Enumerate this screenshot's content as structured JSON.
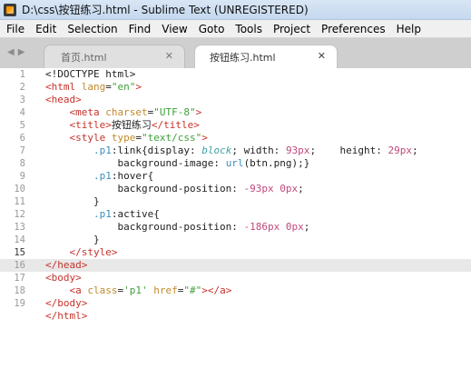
{
  "window": {
    "title": "D:\\css\\按钮练习.html - Sublime Text (UNREGISTERED)"
  },
  "menu": [
    "File",
    "Edit",
    "Selection",
    "Find",
    "View",
    "Goto",
    "Tools",
    "Project",
    "Preferences",
    "Help"
  ],
  "tabs": [
    {
      "label": "首页.html",
      "active": false
    },
    {
      "label": "按钮练习.html",
      "active": true
    }
  ],
  "editor": {
    "current_line": 15,
    "line_numbers": [
      "1",
      "2",
      "3",
      "4",
      "5",
      "6",
      "7",
      "8",
      "9",
      "10",
      "11",
      "12",
      "13",
      "14",
      "15",
      "16",
      "17",
      "18",
      "19"
    ],
    "lines": [
      [
        {
          "t": "<!DOCTYPE html>",
          "c": "plain"
        }
      ],
      [
        {
          "t": "<html ",
          "c": "tag"
        },
        {
          "t": "lang",
          "c": "attr"
        },
        {
          "t": "=",
          "c": "plain"
        },
        {
          "t": "\"en\"",
          "c": "str"
        },
        {
          "t": ">",
          "c": "tag"
        }
      ],
      [
        {
          "t": "<head>",
          "c": "tag"
        }
      ],
      [
        {
          "t": "    ",
          "c": "plain"
        },
        {
          "t": "<meta ",
          "c": "tag"
        },
        {
          "t": "charset",
          "c": "attr"
        },
        {
          "t": "=",
          "c": "plain"
        },
        {
          "t": "\"UTF-8\"",
          "c": "str"
        },
        {
          "t": ">",
          "c": "tag"
        }
      ],
      [
        {
          "t": "    ",
          "c": "plain"
        },
        {
          "t": "<title>",
          "c": "tag"
        },
        {
          "t": "按钮练习",
          "c": "plain"
        },
        {
          "t": "</title>",
          "c": "tag"
        }
      ],
      [
        {
          "t": "    ",
          "c": "plain"
        },
        {
          "t": "<style ",
          "c": "tag"
        },
        {
          "t": "type",
          "c": "attr"
        },
        {
          "t": "=",
          "c": "plain"
        },
        {
          "t": "\"text/css\"",
          "c": "str"
        },
        {
          "t": ">",
          "c": "tag"
        }
      ],
      [
        {
          "t": "        ",
          "c": "plain"
        },
        {
          "t": ".p1",
          "c": "fn"
        },
        {
          "t": ":link{display: ",
          "c": "plain"
        },
        {
          "t": "block",
          "c": "ital"
        },
        {
          "t": "; width: ",
          "c": "plain"
        },
        {
          "t": "93px",
          "c": "num"
        },
        {
          "t": ";    height: ",
          "c": "plain"
        },
        {
          "t": "29px",
          "c": "num"
        },
        {
          "t": ";",
          "c": "plain"
        }
      ],
      [
        {
          "t": "            background-image: ",
          "c": "plain"
        },
        {
          "t": "url",
          "c": "fn"
        },
        {
          "t": "(btn.png);}",
          "c": "plain"
        }
      ],
      [
        {
          "t": "        ",
          "c": "plain"
        },
        {
          "t": ".p1",
          "c": "fn"
        },
        {
          "t": ":hover{",
          "c": "plain"
        }
      ],
      [
        {
          "t": "            background-position: ",
          "c": "plain"
        },
        {
          "t": "-93px 0px",
          "c": "num"
        },
        {
          "t": ";",
          "c": "plain"
        }
      ],
      [
        {
          "t": "        }",
          "c": "plain"
        }
      ],
      [
        {
          "t": "        ",
          "c": "plain"
        },
        {
          "t": ".p1",
          "c": "fn"
        },
        {
          "t": ":active{",
          "c": "plain"
        }
      ],
      [
        {
          "t": "            background-position: ",
          "c": "plain"
        },
        {
          "t": "-186px 0px",
          "c": "num"
        },
        {
          "t": ";",
          "c": "plain"
        }
      ],
      [
        {
          "t": "        }",
          "c": "plain"
        }
      ],
      [
        {
          "t": "    ",
          "c": "plain"
        },
        {
          "t": "</style>",
          "c": "tag"
        }
      ],
      [
        {
          "t": "</head>",
          "c": "tag"
        }
      ],
      [
        {
          "t": "<body>",
          "c": "tag"
        }
      ],
      [
        {
          "t": "    ",
          "c": "plain"
        },
        {
          "t": "<a ",
          "c": "tag"
        },
        {
          "t": "class",
          "c": "attr"
        },
        {
          "t": "=",
          "c": "plain"
        },
        {
          "t": "'p1'",
          "c": "str"
        },
        {
          "t": " ",
          "c": "plain"
        },
        {
          "t": "href",
          "c": "attr"
        },
        {
          "t": "=",
          "c": "plain"
        },
        {
          "t": "\"#\"",
          "c": "str"
        },
        {
          "t": "></a>",
          "c": "tag"
        }
      ],
      [
        {
          "t": "</body>",
          "c": "tag"
        }
      ],
      [
        {
          "t": "</html>",
          "c": "tag"
        }
      ]
    ]
  }
}
